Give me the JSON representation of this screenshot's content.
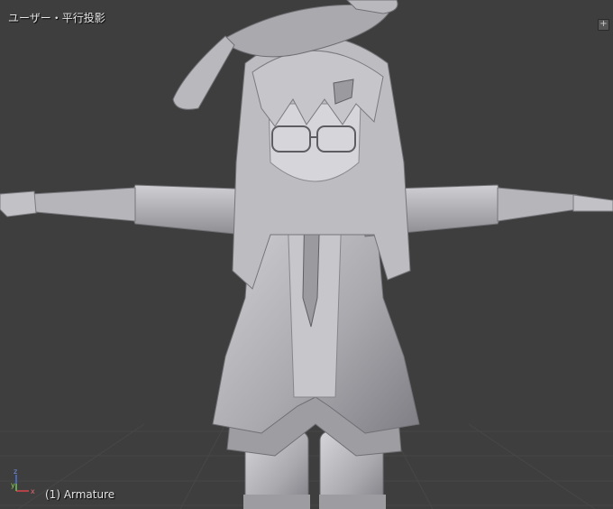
{
  "viewport": {
    "view_label": "ユーザー・平行投影",
    "object_label": "(1) Armature",
    "toggle_icon": "+",
    "axes": {
      "z_label": "z",
      "y_label": "y",
      "x_label": "x"
    },
    "colors": {
      "background": "#3e3e3e",
      "grid_line": "#474747",
      "model": "#b4b4b8",
      "axis_x": "#d9434a",
      "axis_y": "#6bbf3a",
      "axis_z": "#4a72d8"
    }
  }
}
